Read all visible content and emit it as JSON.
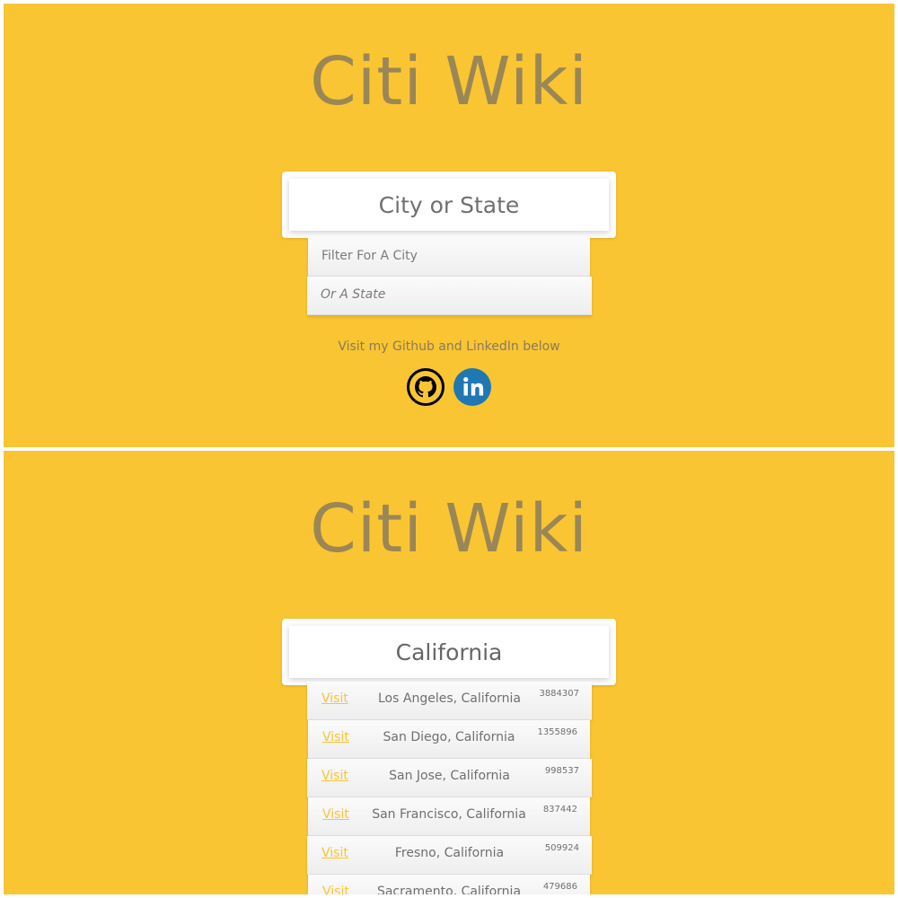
{
  "colors": {
    "background": "#f9c532",
    "title": "#9b8656",
    "link": "#f9c532",
    "linkedin": "#1f78b4"
  },
  "top_view": {
    "title": "Citi Wiki",
    "search": {
      "placeholder": "City or State",
      "value": ""
    },
    "hints": [
      {
        "label": "Filter For A City"
      },
      {
        "label": "Or A State"
      }
    ],
    "social": {
      "text": "Visit my Github and LinkedIn below",
      "icons": [
        "github-icon",
        "linkedin-icon"
      ]
    }
  },
  "bottom_view": {
    "title": "Citi Wiki",
    "search": {
      "value": "California"
    },
    "results": [
      {
        "link": "Visit",
        "name": "Los Angeles, California",
        "population": "3884307"
      },
      {
        "link": "Visit",
        "name": "San Diego, California",
        "population": "1355896"
      },
      {
        "link": "Visit",
        "name": "San Jose, California",
        "population": "998537"
      },
      {
        "link": "Visit",
        "name": "San Francisco, California",
        "population": "837442"
      },
      {
        "link": "Visit",
        "name": "Fresno, California",
        "population": "509924"
      },
      {
        "link": "Visit",
        "name": "Sacramento, California",
        "population": "479686"
      }
    ]
  }
}
